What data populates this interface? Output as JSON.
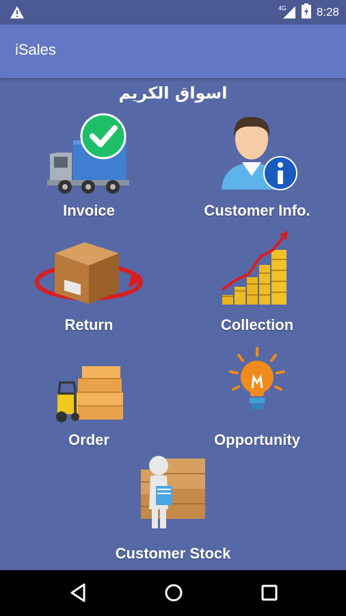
{
  "status_bar": {
    "time": "8:28",
    "network": "4G",
    "icons": [
      "warning-icon",
      "signal-icon",
      "battery-icon"
    ]
  },
  "app_bar": {
    "title": "iSales"
  },
  "store_name": "اسواق الكريم",
  "menu": {
    "invoice": "Invoice",
    "customer_info": "Customer Info.",
    "return": "Return",
    "collection": "Collection",
    "order": "Order",
    "opportunity": "Opportunity",
    "customer_stock": "Customer Stock"
  },
  "nav_bar": {
    "icons": [
      "back-icon",
      "home-icon",
      "recents-icon"
    ]
  },
  "colors": {
    "background": "#5768a6",
    "app_bar": "#6377c4",
    "status_bar": "#4c5a94"
  }
}
